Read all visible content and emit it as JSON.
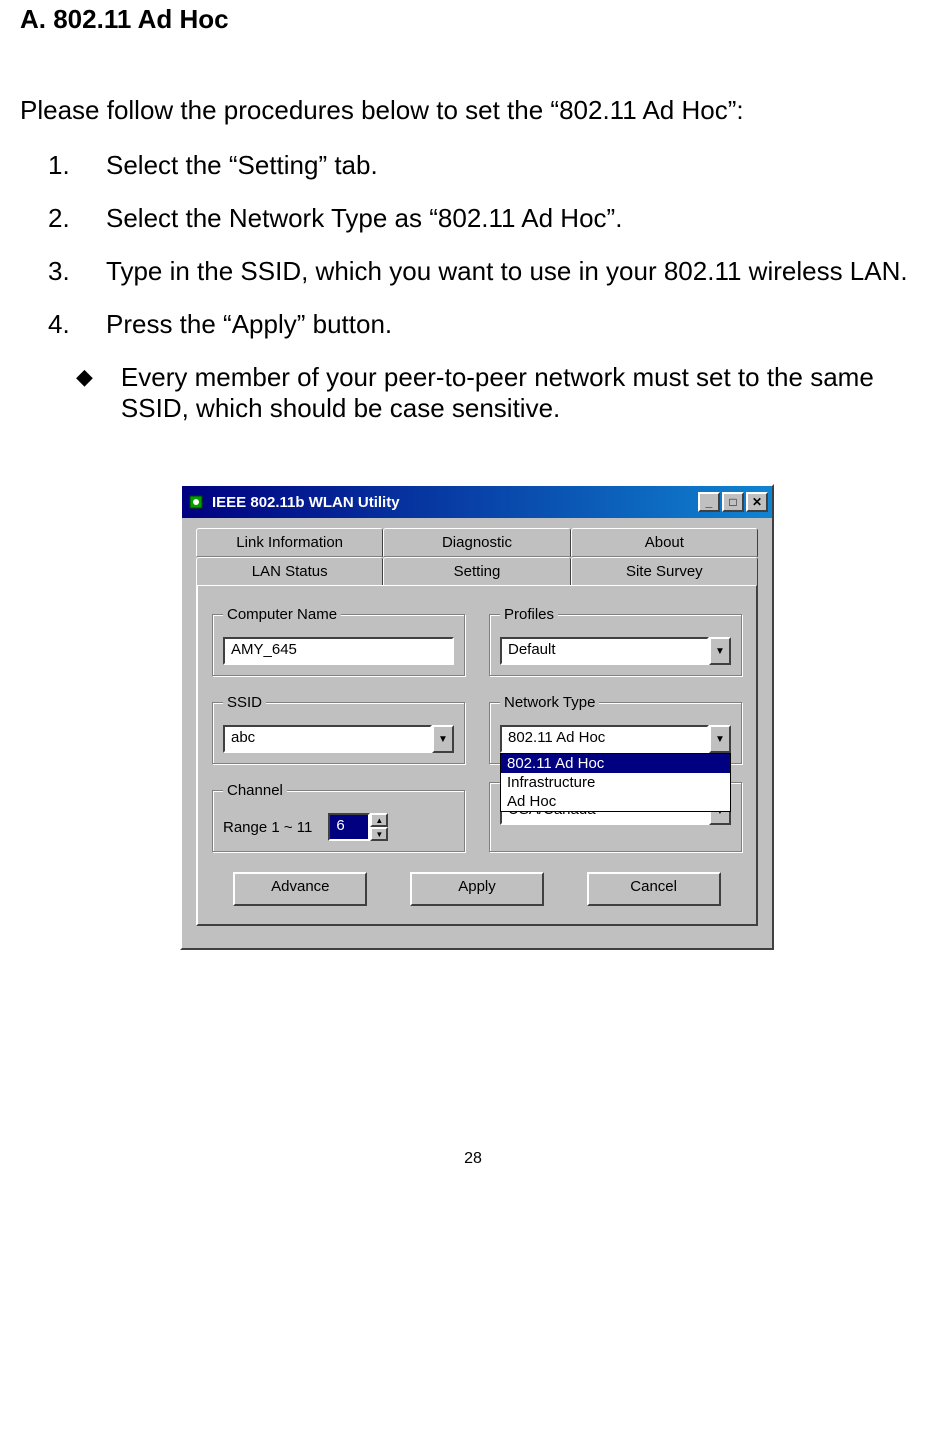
{
  "section_heading": "A. 802.11 Ad Hoc",
  "intro": "Please follow the procedures below to set the “802.11 Ad Hoc”:",
  "steps": [
    {
      "num": "1.",
      "text": "Select the “Setting” tab."
    },
    {
      "num": "2.",
      "text": "Select the Network Type as “802.11 Ad Hoc”."
    },
    {
      "num": "3.",
      "text": "Type in the SSID, which you want to use in your 802.11 wireless LAN."
    },
    {
      "num": "4.",
      "text": "Press the “Apply” button."
    }
  ],
  "note": "Every member of your peer-to-peer network must set to the same SSID, which should be case sensitive.",
  "window": {
    "title": "IEEE 802.11b WLAN Utility",
    "tabs_row1": [
      "Link Information",
      "Diagnostic",
      "About"
    ],
    "tabs_row2": [
      "LAN Status",
      "Setting",
      "Site Survey"
    ],
    "active_tab": "Setting",
    "groups": {
      "computer_name": {
        "legend": "Computer Name",
        "value": "AMY_645"
      },
      "profiles": {
        "legend": "Profiles",
        "value": "Default"
      },
      "ssid": {
        "legend": "SSID",
        "value": "abc"
      },
      "network_type": {
        "legend": "Network Type",
        "value": "802.11 Ad Hoc",
        "options": [
          "802.11 Ad Hoc",
          "Infrastructure",
          "Ad Hoc"
        ],
        "selected_index": 0
      },
      "channel": {
        "legend": "Channel",
        "range_label": "Range 1 ~ 11",
        "value": "6"
      },
      "country": {
        "value": "USA/Canada"
      }
    },
    "buttons": {
      "advance": "Advance",
      "apply": "Apply",
      "cancel": "Cancel"
    }
  },
  "page_number": "28"
}
